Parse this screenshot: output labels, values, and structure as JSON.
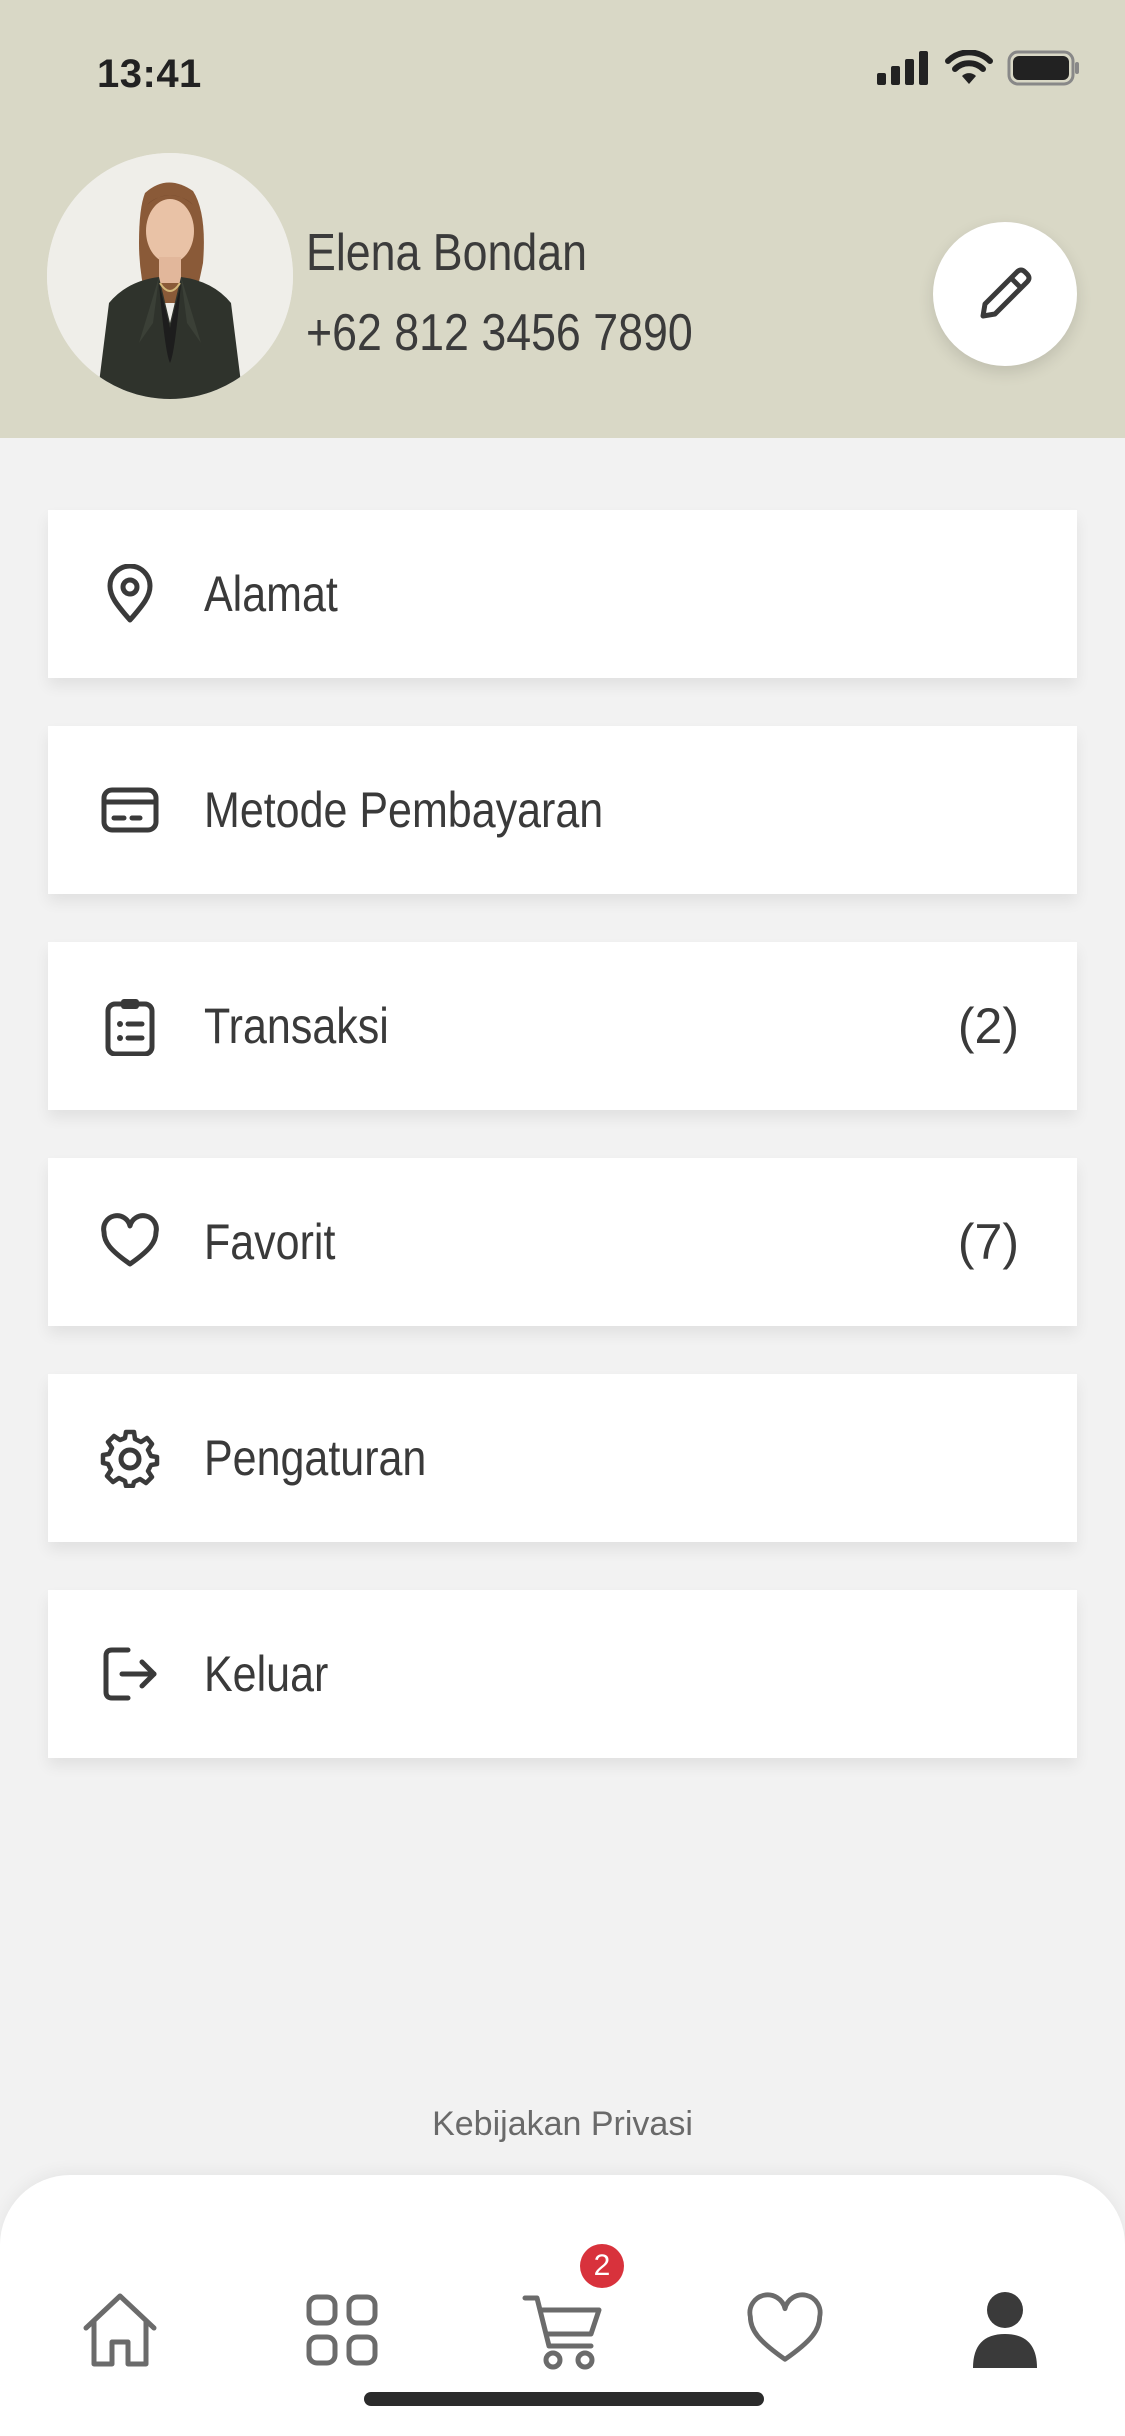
{
  "status_bar": {
    "time": "13:41"
  },
  "profile": {
    "name": "Elena Bondan",
    "phone": "+62 812 3456 7890"
  },
  "menu": {
    "items": [
      {
        "label": "Alamat",
        "icon": "location-pin-icon",
        "count": ""
      },
      {
        "label": "Metode Pembayaran",
        "icon": "credit-card-icon",
        "count": ""
      },
      {
        "label": "Transaksi",
        "icon": "clipboard-list-icon",
        "count": "(2)"
      },
      {
        "label": "Favorit",
        "icon": "heart-icon",
        "count": "(7)"
      },
      {
        "label": "Pengaturan",
        "icon": "gear-icon",
        "count": ""
      },
      {
        "label": "Keluar",
        "icon": "logout-icon",
        "count": ""
      }
    ]
  },
  "footer": {
    "privacy": "Kebijakan Privasi"
  },
  "bottom_nav": {
    "items": [
      "home-icon",
      "grid-icon",
      "cart-icon",
      "heart-icon",
      "user-icon"
    ],
    "cart_badge": "2",
    "active": "user-icon"
  },
  "colors": {
    "header_bg": "#d9d8c6",
    "page_bg": "#f2f2f2",
    "badge": "#d8323c"
  }
}
